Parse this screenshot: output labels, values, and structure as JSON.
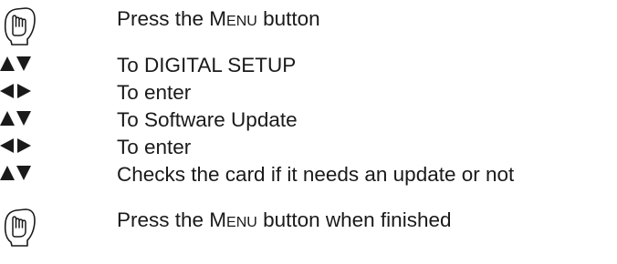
{
  "steps": [
    {
      "icon": "press-hand-icon",
      "text_before": "Press the ",
      "button_name": "Menu",
      "text_after": " button"
    },
    {
      "icon": "up-down-arrows-icon",
      "text": "To DIGITAL SETUP"
    },
    {
      "icon": "left-right-arrows-icon",
      "text": "To enter"
    },
    {
      "icon": "up-down-arrows-icon",
      "text": "To Software Update"
    },
    {
      "icon": "left-right-arrows-icon",
      "text": "To enter"
    },
    {
      "icon": "up-down-arrows-icon",
      "text": "Checks the card if it needs an update or not"
    },
    {
      "icon": "press-hand-icon",
      "text_before": "Press the ",
      "button_name": "Menu",
      "text_after": " button when finished"
    }
  ],
  "colors": {
    "text": "#1a1a1a",
    "icon": "#1a1a1a",
    "background": "#ffffff"
  }
}
